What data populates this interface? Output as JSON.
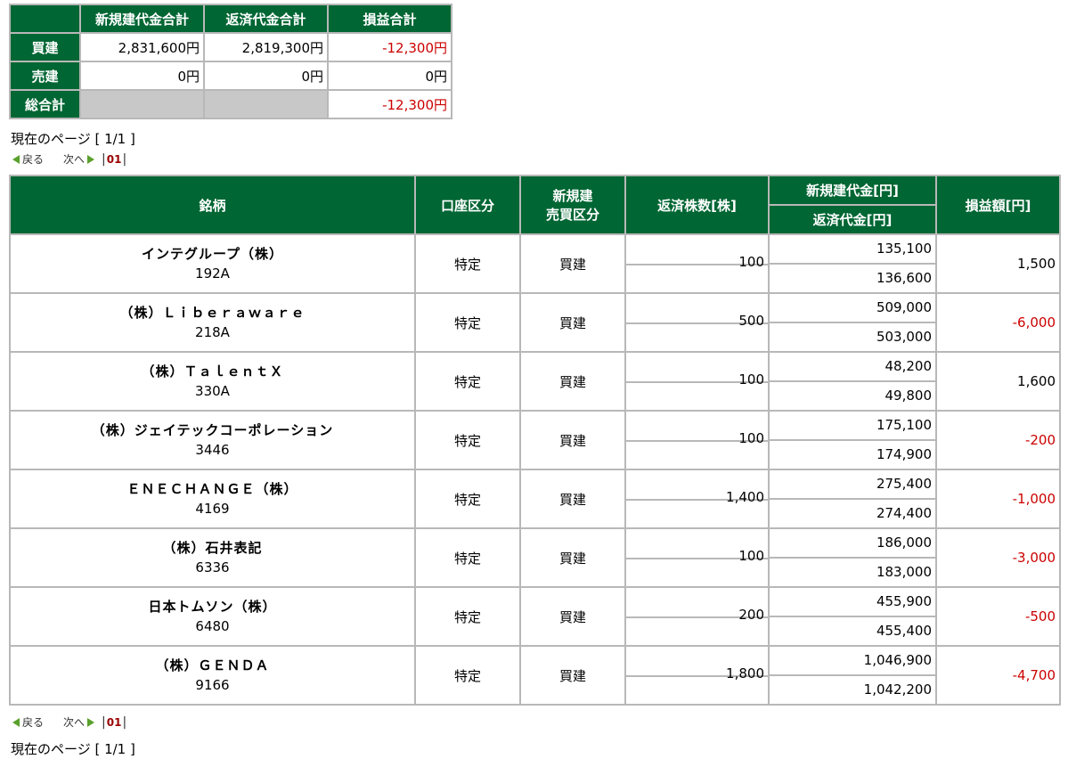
{
  "summary": {
    "headers": [
      "新規建代金合計",
      "返済代金合計",
      "損益合計"
    ],
    "rows": [
      {
        "label": "買建",
        "new_total": "2,831,600円",
        "repay_total": "2,819,300円",
        "pl": "-12,300円"
      },
      {
        "label": "売建",
        "new_total": "0円",
        "repay_total": "0円",
        "pl": "0円"
      },
      {
        "label": "総合計",
        "new_total": "",
        "repay_total": "",
        "pl": "-12,300円"
      }
    ]
  },
  "page_info": "現在のページ [ 1/1 ]",
  "pager": {
    "prev": "戻る",
    "next": "次へ",
    "sep": "|",
    "page": "01"
  },
  "main": {
    "headers": {
      "stock": "銘柄",
      "account": "口座区分",
      "trade_type_1": "新規建",
      "trade_type_2": "売買区分",
      "qty": "返済株数[株]",
      "new_amount": "新規建代金[円]",
      "repay_amount": "返済代金[円]",
      "pl": "損益額[円]"
    },
    "rows": [
      {
        "name": "インテグループ（株）",
        "code": "192A",
        "account": "特定",
        "type": "買建",
        "qty": "100",
        "new_amt": "135,100",
        "repay_amt": "136,600",
        "pl": "1,500"
      },
      {
        "name": "（株）Ｌｉｂｅｒａｗａｒｅ",
        "code": "218A",
        "account": "特定",
        "type": "買建",
        "qty": "500",
        "new_amt": "509,000",
        "repay_amt": "503,000",
        "pl": "-6,000"
      },
      {
        "name": "（株）ＴａｌｅｎｔＸ",
        "code": "330A",
        "account": "特定",
        "type": "買建",
        "qty": "100",
        "new_amt": "48,200",
        "repay_amt": "49,800",
        "pl": "1,600"
      },
      {
        "name": "（株）ジェイテックコーポレーション",
        "code": "3446",
        "account": "特定",
        "type": "買建",
        "qty": "100",
        "new_amt": "175,100",
        "repay_amt": "174,900",
        "pl": "-200"
      },
      {
        "name": "ＥＮＥＣＨＡＮＧＥ（株）",
        "code": "4169",
        "account": "特定",
        "type": "買建",
        "qty": "1,400",
        "new_amt": "275,400",
        "repay_amt": "274,400",
        "pl": "-1,000"
      },
      {
        "name": "（株）石井表記",
        "code": "6336",
        "account": "特定",
        "type": "買建",
        "qty": "100",
        "new_amt": "186,000",
        "repay_amt": "183,000",
        "pl": "-3,000"
      },
      {
        "name": "日本トムソン（株）",
        "code": "6480",
        "account": "特定",
        "type": "買建",
        "qty": "200",
        "new_amt": "455,900",
        "repay_amt": "455,400",
        "pl": "-500"
      },
      {
        "name": "（株）ＧＥＮＤＡ",
        "code": "9166",
        "account": "特定",
        "type": "買建",
        "qty": "1,800",
        "new_amt": "1,046,900",
        "repay_amt": "1,042,200",
        "pl": "-4,700"
      }
    ]
  },
  "colors": {
    "header_bg": "#006633",
    "negative": "#cc0000",
    "pager_arrow": "#5aa02c",
    "page_link": "#990000"
  }
}
